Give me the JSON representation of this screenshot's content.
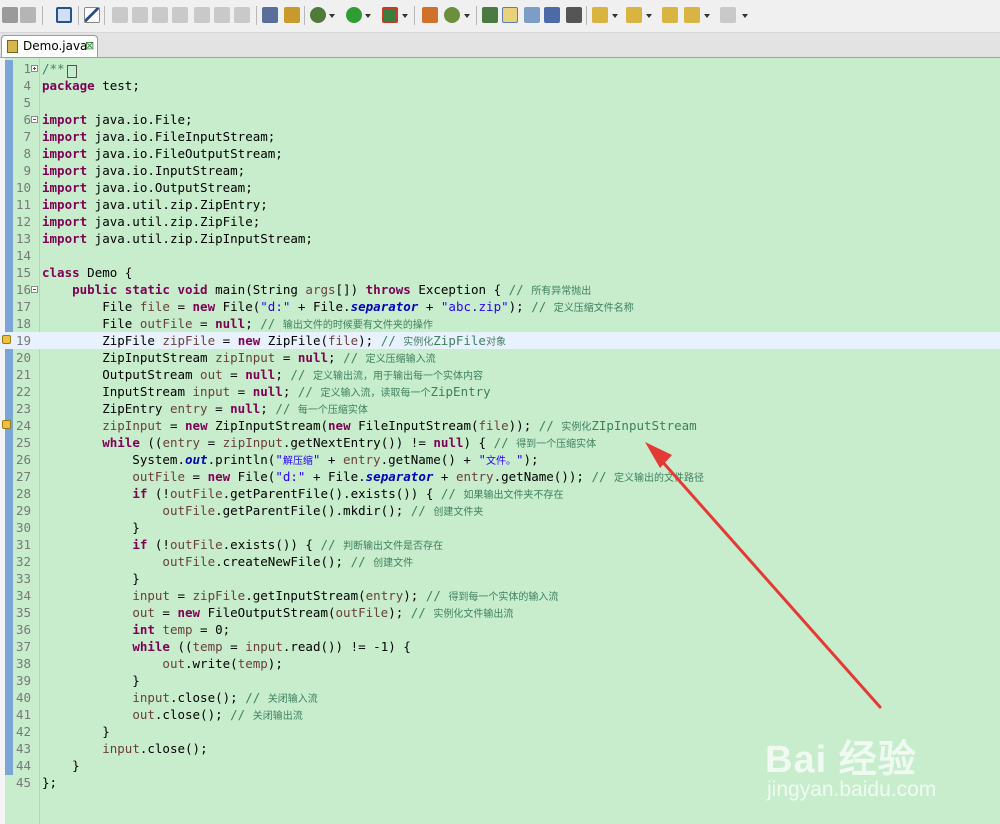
{
  "tab": {
    "label": "Demo.java",
    "close": "⊠"
  },
  "watermark": {
    "brand": "Bai  经验",
    "site": "jingyan.baidu.com"
  },
  "colors": {
    "editor_bg": "#c7edcc",
    "keyword": "#7f0055",
    "string": "#2a00ff",
    "comment": "#3f7f5f",
    "field": "#0000c0",
    "local_var": "#6a3e3e",
    "current_line": "#e8f2fe",
    "arrow": "#e53935"
  },
  "lines": [
    {
      "n": "1",
      "fold": "plus",
      "parts": [
        [
          "cm",
          "/**"
        ],
        [
          "box",
          "□"
        ]
      ]
    },
    {
      "n": "4",
      "parts": [
        [
          "kw",
          "package"
        ],
        [
          "t",
          " test;"
        ]
      ]
    },
    {
      "n": "5",
      "parts": []
    },
    {
      "n": "6",
      "fold": "minus",
      "parts": [
        [
          "kw",
          "import"
        ],
        [
          "t",
          " java.io.File;"
        ]
      ]
    },
    {
      "n": "7",
      "parts": [
        [
          "kw",
          "import"
        ],
        [
          "t",
          " java.io.FileInputStream;"
        ]
      ]
    },
    {
      "n": "8",
      "parts": [
        [
          "kw",
          "import"
        ],
        [
          "t",
          " java.io.FileOutputStream;"
        ]
      ]
    },
    {
      "n": "9",
      "parts": [
        [
          "kw",
          "import"
        ],
        [
          "t",
          " java.io.InputStream;"
        ]
      ]
    },
    {
      "n": "10",
      "parts": [
        [
          "kw",
          "import"
        ],
        [
          "t",
          " java.io.OutputStream;"
        ]
      ]
    },
    {
      "n": "11",
      "parts": [
        [
          "kw",
          "import"
        ],
        [
          "t",
          " java.util.zip.ZipEntry;"
        ]
      ]
    },
    {
      "n": "12",
      "parts": [
        [
          "kw",
          "import"
        ],
        [
          "t",
          " java.util.zip.ZipFile;"
        ]
      ]
    },
    {
      "n": "13",
      "parts": [
        [
          "kw",
          "import"
        ],
        [
          "t",
          " java.util.zip.ZipInputStream;"
        ]
      ]
    },
    {
      "n": "14",
      "parts": []
    },
    {
      "n": "15",
      "parts": [
        [
          "kw",
          "class"
        ],
        [
          "t",
          " Demo {"
        ]
      ]
    },
    {
      "n": "16",
      "fold": "minus",
      "parts": [
        [
          "t",
          "    "
        ],
        [
          "kw",
          "public static void"
        ],
        [
          "t",
          " main(String "
        ],
        [
          "var",
          "args"
        ],
        [
          "t",
          "[]) "
        ],
        [
          "kw",
          "throws"
        ],
        [
          "t",
          " Exception { "
        ],
        [
          "cm",
          "// "
        ],
        [
          "cmcjk",
          "所有异常抛出"
        ]
      ]
    },
    {
      "n": "17",
      "parts": [
        [
          "t",
          "        File "
        ],
        [
          "var",
          "file"
        ],
        [
          "t",
          " = "
        ],
        [
          "kw",
          "new"
        ],
        [
          "t",
          " File("
        ],
        [
          "str",
          "\"d:\""
        ],
        [
          "t",
          " + File."
        ],
        [
          "sfld",
          "separator"
        ],
        [
          "t",
          " + "
        ],
        [
          "str",
          "\"abc.zip\""
        ],
        [
          "t",
          "); "
        ],
        [
          "cm",
          "// "
        ],
        [
          "cmcjk",
          "定义压缩文件名称"
        ]
      ]
    },
    {
      "n": "18",
      "parts": [
        [
          "t",
          "        File "
        ],
        [
          "var",
          "outFile"
        ],
        [
          "t",
          " = "
        ],
        [
          "kw",
          "null"
        ],
        [
          "t",
          "; "
        ],
        [
          "cm",
          "// "
        ],
        [
          "cmcjk",
          "输出文件的时候要有文件夹的操作"
        ]
      ]
    },
    {
      "n": "19",
      "cur": true,
      "marker": true,
      "parts": [
        [
          "t",
          "        ZipFile "
        ],
        [
          "var",
          "zipFile"
        ],
        [
          "t",
          " = "
        ],
        [
          "kw",
          "new"
        ],
        [
          "t",
          " ZipFile("
        ],
        [
          "var",
          "file"
        ],
        [
          "t",
          "); "
        ],
        [
          "cm",
          "// "
        ],
        [
          "cmcjk",
          "实例化"
        ],
        [
          "cm",
          "ZipFile"
        ],
        [
          "cmcjk",
          "对象"
        ]
      ]
    },
    {
      "n": "20",
      "parts": [
        [
          "t",
          "        ZipInputStream "
        ],
        [
          "var",
          "zipInput"
        ],
        [
          "t",
          " = "
        ],
        [
          "kw",
          "null"
        ],
        [
          "t",
          "; "
        ],
        [
          "cm",
          "// "
        ],
        [
          "cmcjk",
          "定义压缩输入流"
        ]
      ]
    },
    {
      "n": "21",
      "parts": [
        [
          "t",
          "        OutputStream "
        ],
        [
          "var",
          "out"
        ],
        [
          "t",
          " = "
        ],
        [
          "kw",
          "null"
        ],
        [
          "t",
          "; "
        ],
        [
          "cm",
          "// "
        ],
        [
          "cmcjk",
          "定义输出流，用于输出每一个实体内容"
        ]
      ]
    },
    {
      "n": "22",
      "parts": [
        [
          "t",
          "        InputStream "
        ],
        [
          "var",
          "input"
        ],
        [
          "t",
          " = "
        ],
        [
          "kw",
          "null"
        ],
        [
          "t",
          "; "
        ],
        [
          "cm",
          "// "
        ],
        [
          "cmcjk",
          "定义输入流，读取每一个"
        ],
        [
          "cm",
          "ZipEntry"
        ]
      ]
    },
    {
      "n": "23",
      "parts": [
        [
          "t",
          "        ZipEntry "
        ],
        [
          "var",
          "entry"
        ],
        [
          "t",
          " = "
        ],
        [
          "kw",
          "null"
        ],
        [
          "t",
          "; "
        ],
        [
          "cm",
          "// "
        ],
        [
          "cmcjk",
          "每一个压缩实体"
        ]
      ]
    },
    {
      "n": "24",
      "marker": true,
      "parts": [
        [
          "t",
          "        "
        ],
        [
          "var",
          "zipInput"
        ],
        [
          "t",
          " = "
        ],
        [
          "kw",
          "new"
        ],
        [
          "t",
          " ZipInputStream("
        ],
        [
          "kw",
          "new"
        ],
        [
          "t",
          " FileInputStream("
        ],
        [
          "var",
          "file"
        ],
        [
          "t",
          "));"
        ],
        [
          "cm",
          " // "
        ],
        [
          "cmcjk",
          "实例化"
        ],
        [
          "cm",
          "ZIpInputStream"
        ]
      ]
    },
    {
      "n": "25",
      "parts": [
        [
          "t",
          "        "
        ],
        [
          "kw",
          "while"
        ],
        [
          "t",
          " (("
        ],
        [
          "var",
          "entry"
        ],
        [
          "t",
          " = "
        ],
        [
          "var",
          "zipInput"
        ],
        [
          "t",
          ".getNextEntry()) != "
        ],
        [
          "kw",
          "null"
        ],
        [
          "t",
          ") { "
        ],
        [
          "cm",
          "// "
        ],
        [
          "cmcjk",
          "得到一个压缩实体"
        ]
      ]
    },
    {
      "n": "26",
      "parts": [
        [
          "t",
          "            System."
        ],
        [
          "sfld",
          "out"
        ],
        [
          "t",
          ".println("
        ],
        [
          "str",
          "\""
        ],
        [
          "strcjk",
          "解压缩"
        ],
        [
          "str",
          "\""
        ],
        [
          "t",
          " + "
        ],
        [
          "var",
          "entry"
        ],
        [
          "t",
          ".getName() + "
        ],
        [
          "str",
          "\""
        ],
        [
          "strcjk",
          "文件。"
        ],
        [
          "str",
          "\""
        ],
        [
          "t",
          ");"
        ]
      ]
    },
    {
      "n": "27",
      "parts": [
        [
          "t",
          "            "
        ],
        [
          "var",
          "outFile"
        ],
        [
          "t",
          " = "
        ],
        [
          "kw",
          "new"
        ],
        [
          "t",
          " File("
        ],
        [
          "str",
          "\"d:\""
        ],
        [
          "t",
          " + File."
        ],
        [
          "sfld",
          "separator"
        ],
        [
          "t",
          " + "
        ],
        [
          "var",
          "entry"
        ],
        [
          "t",
          ".getName()); "
        ],
        [
          "cm",
          "// "
        ],
        [
          "cmcjk",
          "定义输出的文件路径"
        ]
      ]
    },
    {
      "n": "28",
      "parts": [
        [
          "t",
          "            "
        ],
        [
          "kw",
          "if"
        ],
        [
          "t",
          " (!"
        ],
        [
          "var",
          "outFile"
        ],
        [
          "t",
          ".getParentFile().exists()) { "
        ],
        [
          "cm",
          "// "
        ],
        [
          "cmcjk",
          "如果输出文件夹不存在"
        ]
      ]
    },
    {
      "n": "29",
      "parts": [
        [
          "t",
          "                "
        ],
        [
          "var",
          "outFile"
        ],
        [
          "t",
          ".getParentFile().mkdir(); "
        ],
        [
          "cm",
          "// "
        ],
        [
          "cmcjk",
          "创建文件夹"
        ]
      ]
    },
    {
      "n": "30",
      "parts": [
        [
          "t",
          "            }"
        ]
      ]
    },
    {
      "n": "31",
      "parts": [
        [
          "t",
          "            "
        ],
        [
          "kw",
          "if"
        ],
        [
          "t",
          " (!"
        ],
        [
          "var",
          "outFile"
        ],
        [
          "t",
          ".exists()) { "
        ],
        [
          "cm",
          "// "
        ],
        [
          "cmcjk",
          "判断输出文件是否存在"
        ]
      ]
    },
    {
      "n": "32",
      "parts": [
        [
          "t",
          "                "
        ],
        [
          "var",
          "outFile"
        ],
        [
          "t",
          ".createNewFile(); "
        ],
        [
          "cm",
          "// "
        ],
        [
          "cmcjk",
          "创建文件"
        ]
      ]
    },
    {
      "n": "33",
      "parts": [
        [
          "t",
          "            }"
        ]
      ]
    },
    {
      "n": "34",
      "parts": [
        [
          "t",
          "            "
        ],
        [
          "var",
          "input"
        ],
        [
          "t",
          " = "
        ],
        [
          "var",
          "zipFile"
        ],
        [
          "t",
          ".getInputStream("
        ],
        [
          "var",
          "entry"
        ],
        [
          "t",
          "); "
        ],
        [
          "cm",
          "// "
        ],
        [
          "cmcjk",
          "得到每一个实体的输入流"
        ]
      ]
    },
    {
      "n": "35",
      "parts": [
        [
          "t",
          "            "
        ],
        [
          "var",
          "out"
        ],
        [
          "t",
          " = "
        ],
        [
          "kw",
          "new"
        ],
        [
          "t",
          " FileOutputStream("
        ],
        [
          "var",
          "outFile"
        ],
        [
          "t",
          "); "
        ],
        [
          "cm",
          "// "
        ],
        [
          "cmcjk",
          "实例化文件输出流"
        ]
      ]
    },
    {
      "n": "36",
      "parts": [
        [
          "t",
          "            "
        ],
        [
          "kw",
          "int"
        ],
        [
          "t",
          " "
        ],
        [
          "var",
          "temp"
        ],
        [
          "t",
          " = 0;"
        ]
      ]
    },
    {
      "n": "37",
      "parts": [
        [
          "t",
          "            "
        ],
        [
          "kw",
          "while"
        ],
        [
          "t",
          " (("
        ],
        [
          "var",
          "temp"
        ],
        [
          "t",
          " = "
        ],
        [
          "var",
          "input"
        ],
        [
          "t",
          ".read()) != -1) {"
        ]
      ]
    },
    {
      "n": "38",
      "parts": [
        [
          "t",
          "                "
        ],
        [
          "var",
          "out"
        ],
        [
          "t",
          ".write("
        ],
        [
          "var",
          "temp"
        ],
        [
          "t",
          ");"
        ]
      ]
    },
    {
      "n": "39",
      "parts": [
        [
          "t",
          "            }"
        ]
      ]
    },
    {
      "n": "40",
      "parts": [
        [
          "t",
          "            "
        ],
        [
          "var",
          "input"
        ],
        [
          "t",
          ".close(); "
        ],
        [
          "cm",
          "// "
        ],
        [
          "cmcjk",
          "关闭输入流"
        ]
      ]
    },
    {
      "n": "41",
      "parts": [
        [
          "t",
          "            "
        ],
        [
          "var",
          "out"
        ],
        [
          "t",
          ".close(); "
        ],
        [
          "cm",
          "// "
        ],
        [
          "cmcjk",
          "关闭输出流"
        ]
      ]
    },
    {
      "n": "42",
      "parts": [
        [
          "t",
          "        }"
        ]
      ]
    },
    {
      "n": "43",
      "parts": [
        [
          "t",
          "        "
        ],
        [
          "var",
          "input"
        ],
        [
          "t",
          ".close();"
        ]
      ]
    },
    {
      "n": "44",
      "parts": [
        [
          "t",
          "    }"
        ]
      ]
    },
    {
      "n": "45",
      "parts": [
        [
          "t",
          "};"
        ]
      ]
    }
  ]
}
